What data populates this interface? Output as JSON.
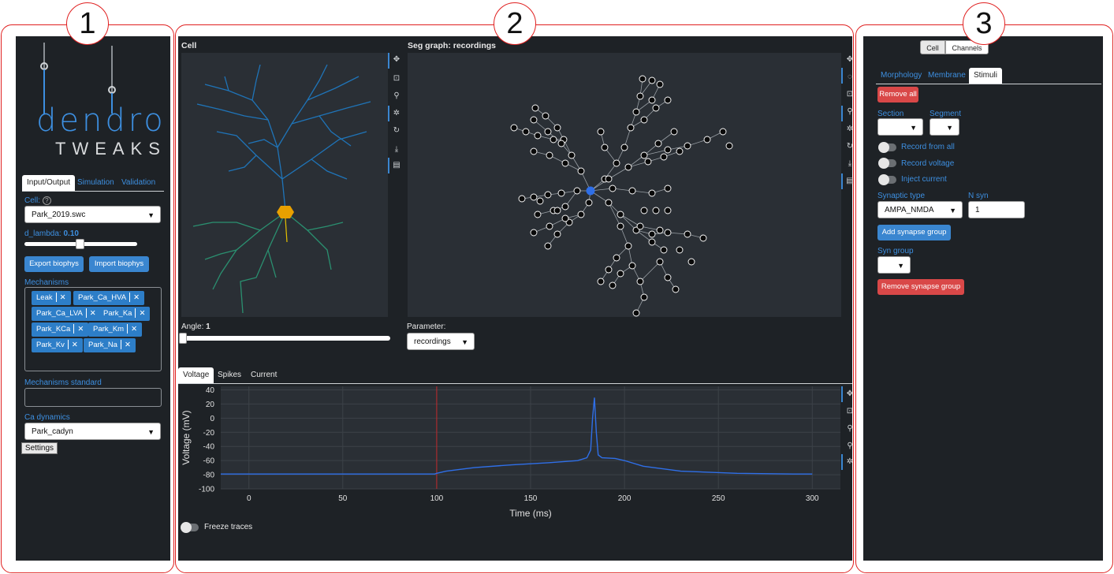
{
  "labels": {
    "panel1": "1",
    "panel2": "2",
    "panel3": "3"
  },
  "logo": {
    "top": "dendro",
    "bottom": "TWEAKS"
  },
  "left": {
    "tabs": [
      "Input/Output",
      "Simulation",
      "Validation"
    ],
    "cell_label": "Cell:",
    "cell_value": "Park_2019.swc",
    "d_lambda_label": "d_lambda:",
    "d_lambda_value": "0.10",
    "d_lambda_fraction": 0.5,
    "export_button": "Export biophys",
    "import_button": "Import biophys",
    "mechanisms_label": "Mechanisms",
    "mechanisms": [
      "Leak",
      "Park_Ca_HVA",
      "Park_Ca_LVA",
      "Park_Ka",
      "Park_KCa",
      "Park_Km",
      "Park_Kv",
      "Park_Na"
    ],
    "mechanisms_standard_label": "Mechanisms standard",
    "ca_dynamics_label": "Ca dynamics",
    "ca_dynamics_value": "Park_cadyn",
    "settings_button": "Settings"
  },
  "center": {
    "cell_title": "Cell",
    "seg_title": "Seg graph: recordings",
    "angle_label": "Angle:",
    "angle_value": "1",
    "parameter_label": "Parameter:",
    "parameter_value": "recordings",
    "plot_tabs": [
      "Voltage",
      "Spikes",
      "Current"
    ],
    "freeze_label": "Freeze traces"
  },
  "chart_data": {
    "type": "line",
    "xlabel": "Time (ms)",
    "ylabel": "Voltage (mV)",
    "xlim": [
      -15,
      315
    ],
    "ylim": [
      -100,
      45
    ],
    "xticks": [
      0,
      50,
      100,
      150,
      200,
      250,
      300
    ],
    "yticks": [
      40,
      20,
      0,
      -20,
      -40,
      -60,
      -80,
      -100
    ],
    "stimulus_marker_x": 100,
    "series": [
      {
        "color": "#2f6fe8",
        "x": [
          -15,
          99,
          100,
          105,
          120,
          140,
          160,
          175,
          180,
          182,
          183,
          184,
          185,
          186,
          188,
          195,
          200,
          210,
          230,
          260,
          290,
          300
        ],
        "y": [
          -79,
          -79,
          -78,
          -75,
          -70,
          -66,
          -63,
          -60,
          -56,
          -45,
          0,
          29,
          -20,
          -52,
          -56,
          -57,
          -60,
          -68,
          -75,
          -78,
          -79,
          -79
        ]
      }
    ]
  },
  "right": {
    "top_toggle": [
      "Cell",
      "Channels"
    ],
    "tabs": [
      "Morphology",
      "Membrane",
      "Stimuli"
    ],
    "remove_all": "Remove all",
    "section_label": "Section",
    "segment_label": "Segment",
    "record_from_all": "Record from all",
    "record_voltage": "Record voltage",
    "inject_current": "Inject current",
    "synaptic_type_label": "Synaptic type",
    "synaptic_type_value": "AMPA_NMDA",
    "n_syn_label": "N syn",
    "n_syn_value": "1",
    "add_synapse_group": "Add synapse group",
    "syn_group_label": "Syn group",
    "remove_synapse_group": "Remove synapse group"
  }
}
